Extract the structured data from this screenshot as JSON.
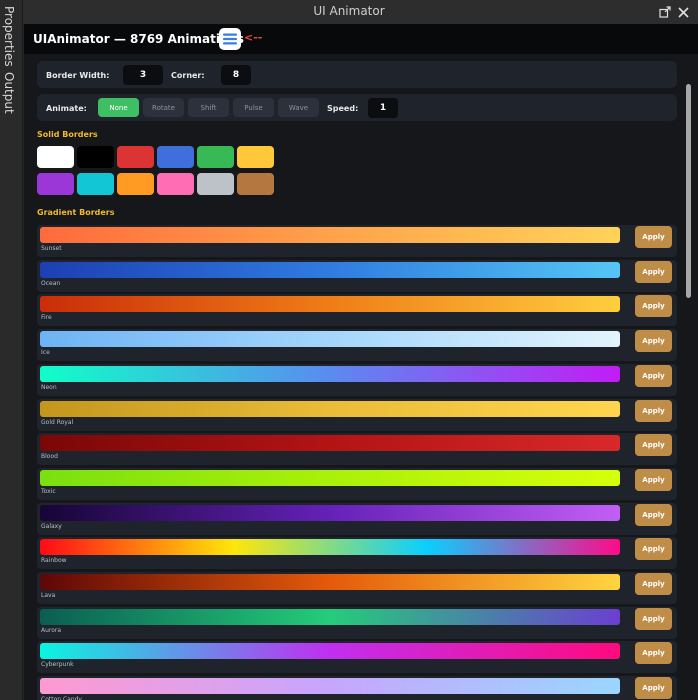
{
  "window": {
    "title": "UI Animator",
    "icons": {
      "undock": "undock-icon",
      "close": "close-icon"
    }
  },
  "dock": {
    "tabs": [
      {
        "label": "Properties"
      },
      {
        "label": "Output"
      }
    ]
  },
  "header": {
    "title": "UIAnimator — 8769 Animations",
    "menu_icon": "hamburger-menu-icon",
    "arrow": "<--",
    "arrow_color": "#e24d3f"
  },
  "settings": {
    "border_width_label": "Border Width:",
    "border_width_value": "3",
    "corner_label": "Corner:",
    "corner_value": "8"
  },
  "animate": {
    "label": "Animate:",
    "options": [
      "None",
      "Rotate",
      "Shift",
      "Pulse",
      "Wave"
    ],
    "selected": "None",
    "speed_label": "Speed:",
    "speed_value": "1"
  },
  "solid_borders": {
    "title": "Solid Borders",
    "colors": [
      "#ffffff",
      "#000000",
      "#dc3434",
      "#3f6fdc",
      "#37b956",
      "#ffc83a",
      "#9b37d6",
      "#12c6d6",
      "#ff9a22",
      "#ff6eb4",
      "#bdc1c8",
      "#b4773f"
    ]
  },
  "gradient_borders": {
    "title": "Gradient Borders",
    "apply_label": "Apply",
    "items": [
      {
        "name": "Sunset",
        "colors": [
          "#ff6a3d",
          "#ffa24b",
          "#ffd35a"
        ]
      },
      {
        "name": "Ocean",
        "colors": [
          "#1d3fb4",
          "#2f7ce0",
          "#55c6f5"
        ]
      },
      {
        "name": "Fire",
        "colors": [
          "#c92d09",
          "#ef7d17",
          "#ffce3f"
        ]
      },
      {
        "name": "Ice",
        "colors": [
          "#6eb3f5",
          "#a4d6fb",
          "#e3f4fd"
        ]
      },
      {
        "name": "Neon",
        "colors": [
          "#10ffc8",
          "#5a8bf0",
          "#c21cf5"
        ]
      },
      {
        "name": "Gold Royal",
        "colors": [
          "#c4961d",
          "#eabc39",
          "#ffd54f"
        ]
      },
      {
        "name": "Blood",
        "colors": [
          "#7a0707",
          "#b21414",
          "#d82929"
        ]
      },
      {
        "name": "Toxic",
        "colors": [
          "#7ae00f",
          "#aaf00a",
          "#d7ff0a"
        ]
      },
      {
        "name": "Galaxy",
        "colors": [
          "#160536",
          "#6521b8",
          "#c25ff5"
        ]
      },
      {
        "name": "Rainbow",
        "colors": [
          "#ff0a16",
          "#ffe60a",
          "#0acfff",
          "#ff0a8a"
        ]
      },
      {
        "name": "Lava",
        "colors": [
          "#5e0707",
          "#e45a0a",
          "#ffd53f"
        ]
      },
      {
        "name": "Aurora",
        "colors": [
          "#0a5e52",
          "#25cc7a",
          "#6b3fd1"
        ]
      },
      {
        "name": "Cyberpunk",
        "colors": [
          "#0af5e0",
          "#c02ff0",
          "#ff0a7e"
        ]
      },
      {
        "name": "Cotton Candy",
        "colors": [
          "#ff9ad0",
          "#c6a6ff",
          "#9ad6ff"
        ]
      }
    ]
  }
}
